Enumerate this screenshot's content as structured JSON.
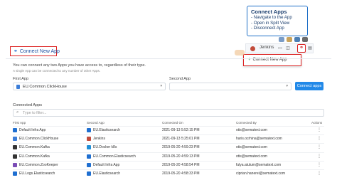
{
  "callout": {
    "title": "Connect Apps",
    "lines": [
      "- Navigate to the App",
      "- Open in Split View",
      "- Disconnect App"
    ]
  },
  "toolbar": {
    "user": "Jenkins",
    "dropdown_item": "Connect New App"
  },
  "header": {
    "connect_label": "Connect New App"
  },
  "description": "You can connect any two Apps you have access to, regardless of their type.",
  "sub_description": "A single App can be connected to any number of other Apps.",
  "form": {
    "first_app_label": "First App",
    "first_app_value": "EU.Common.ClickHouse",
    "second_app_label": "Second App",
    "second_app_value": "",
    "connect_button": "Connect apps"
  },
  "connected": {
    "title": "Connected Apps",
    "filter_placeholder": "Type to filter...",
    "columns": [
      "First App",
      "Second App",
      "Connected On",
      "Connected By",
      "Actions"
    ],
    "rows": [
      {
        "first": "Default Infra App",
        "second": "EU.Elasticsearch",
        "on": "2021-09-13 5:52:15 PM",
        "by": "otis@sematext.com",
        "c1": "#1f6fd1",
        "c2": "#1f6fd1"
      },
      {
        "first": "EU.Common.ClickHouse",
        "second": "Jenkins",
        "on": "2021-09-13 5:25:01 PM",
        "by": "haris.ocrhina@sematext.com",
        "c1": "#3b7dd8",
        "c2": "#c24b3b"
      },
      {
        "first": "EU.Common.Kafka",
        "second": "EU.Docker k8s",
        "on": "2019-05-20 4:59:23 PM",
        "by": "otis@sematext.com",
        "c1": "#333333",
        "c2": "#1f8fd8"
      },
      {
        "first": "EU.Common.Kafka",
        "second": "EU.Common.Elasticsearch",
        "on": "2019-05-20 4:59:13 PM",
        "by": "otis@sematext.com",
        "c1": "#333333",
        "c2": "#1f6fd1"
      },
      {
        "first": "EU.Common.ZooKeeper",
        "second": "Default Infra App",
        "on": "2019-05-20 4:58:54 PM",
        "by": "fulya.atulum@sematext.com",
        "c1": "#7a4bb5",
        "c2": "#1f6fd1"
      },
      {
        "first": "EU.Logs.Elasticsearch",
        "second": "EU.Elasticsearch",
        "on": "2019-05-20 4:58:33 PM",
        "by": "ciprian.hanerei@sematext.com",
        "c1": "#1f6fd1",
        "c2": "#1f6fd1"
      }
    ]
  },
  "colors": {
    "accent": "#2289e8",
    "highlight": "#dd2222",
    "callout_border": "#1e6fc7"
  }
}
